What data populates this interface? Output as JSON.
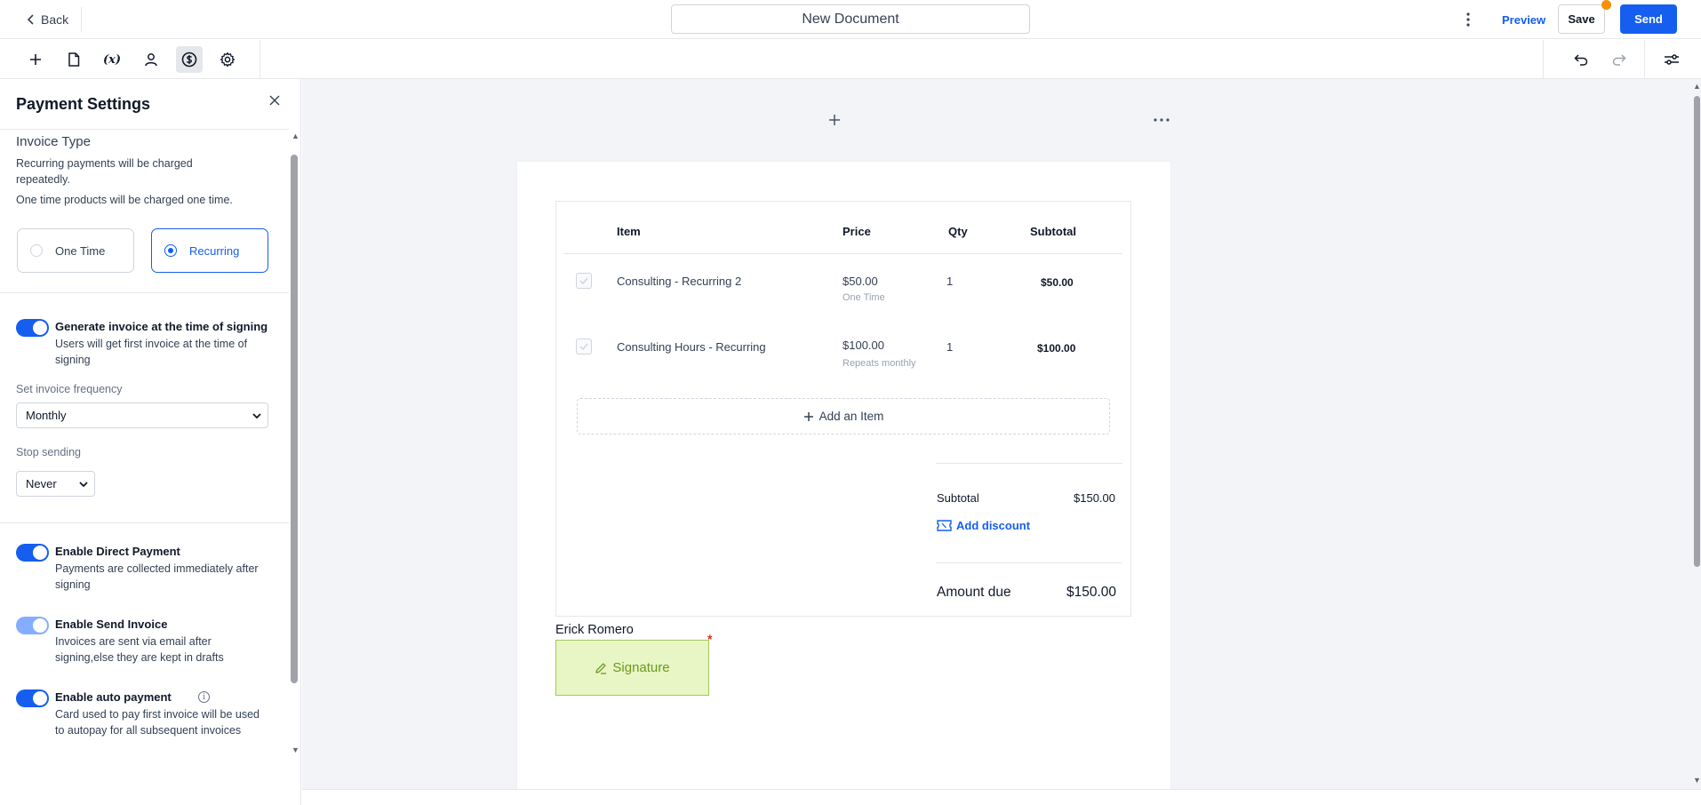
{
  "header": {
    "back_label": "Back",
    "document_title": "New Document",
    "preview_label": "Preview",
    "save_label": "Save",
    "send_label": "Send"
  },
  "toolbar": {
    "tools": [
      "add-icon",
      "page-icon",
      "variables-icon",
      "user-icon",
      "payment-icon",
      "settings-icon"
    ],
    "variables_label": "(x)",
    "active_tool": "payment-icon"
  },
  "panel": {
    "title": "Payment Settings",
    "invoice_type_heading": "Invoice Type",
    "invoice_type_help_1": "Recurring payments will be charged repeatedly.",
    "invoice_type_help_2": "One time products will be charged one time.",
    "option_one_time": "One Time",
    "option_recurring": "Recurring",
    "selected_option": "Recurring",
    "generate_invoice": {
      "label": "Generate invoice at the time of signing",
      "desc": "Users will get first invoice at the time of signing",
      "enabled": true
    },
    "frequency_label": "Set invoice frequency",
    "frequency_value": "Monthly",
    "stop_sending_label": "Stop sending",
    "stop_sending_value": "Never",
    "direct_payment": {
      "label": "Enable Direct Payment",
      "desc": "Payments are collected immediately after signing",
      "enabled": true
    },
    "send_invoice": {
      "label": "Enable Send Invoice",
      "desc": "Invoices are sent via email after signing,else they are kept in drafts",
      "enabled": true
    },
    "auto_payment": {
      "label": "Enable auto payment",
      "desc": "Card used to pay first invoice will be used to autopay for all subsequent invoices",
      "enabled": true
    },
    "info_glyph": "i"
  },
  "table": {
    "headers": {
      "item": "Item",
      "price": "Price",
      "qty": "Qty",
      "subtotal": "Subtotal"
    },
    "rows": [
      {
        "item": "Consulting - Recurring 2",
        "price": "$50.00",
        "price_note": "One Time",
        "qty": "1",
        "subtotal": "$50.00"
      },
      {
        "item": "Consulting Hours - Recurring",
        "price": "$100.00",
        "price_note": "Repeats monthly",
        "qty": "1",
        "subtotal": "$100.00"
      }
    ],
    "add_item_label": "Add an Item"
  },
  "summary": {
    "subtotal_label": "Subtotal",
    "subtotal_value": "$150.00",
    "add_discount_label": "Add discount",
    "amount_due_label": "Amount due",
    "amount_due_value": "$150.00"
  },
  "signature": {
    "signer_name": "Erick Romero",
    "field_label": "Signature",
    "required_mark": "*"
  },
  "colors": {
    "accent": "#155eef",
    "signature_fill": "#e8f5c4",
    "unsaved_dot": "#f79009"
  }
}
